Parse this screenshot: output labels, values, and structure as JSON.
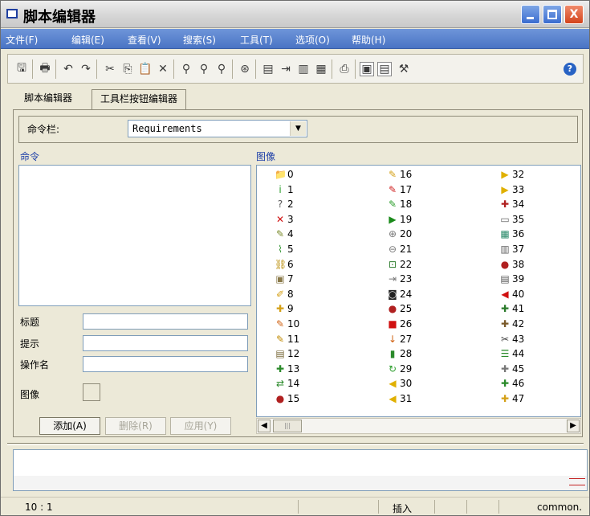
{
  "window": {
    "title": "脚本编辑器",
    "controls": {
      "minimize": "_",
      "maximize": "□",
      "close": "X"
    }
  },
  "menu": [
    {
      "label": "文件(F)"
    },
    {
      "label": "编辑(E)"
    },
    {
      "label": "查看(V)"
    },
    {
      "label": "搜索(S)"
    },
    {
      "label": "工具(T)"
    },
    {
      "label": "选项(O)"
    },
    {
      "label": "帮助(H)"
    }
  ],
  "toolbar": {
    "icons": [
      "save-icon",
      "print-icon",
      "undo-icon",
      "redo-icon",
      "cut-icon",
      "copy-icon",
      "paste-icon",
      "delete-icon",
      "find-icon",
      "find-next-icon",
      "replace-icon",
      "goto-icon",
      "list-icon",
      "insert-icon",
      "doc-icon",
      "doc2-icon",
      "preview-icon",
      "view1-icon",
      "view2-icon",
      "tools-icon"
    ],
    "help_label": "?"
  },
  "tabs": [
    {
      "label": "脚本编辑器",
      "active": false
    },
    {
      "label": "工具栏按钮编辑器",
      "active": true
    }
  ],
  "command_bar": {
    "label": "命令栏:",
    "selected": "Requirements"
  },
  "sections": {
    "commands": "命令",
    "images": "图像"
  },
  "form": {
    "title_label": "标题",
    "tip_label": "提示",
    "action_label": "操作名",
    "image_label": "图像"
  },
  "buttons": {
    "add": "添加(A)",
    "delete": "删除(R)",
    "apply": "应用(Y)"
  },
  "images": [
    {
      "n": "0",
      "icon": "📁",
      "color": "#d4a017"
    },
    {
      "n": "1",
      "icon": "i",
      "color": "#2a9d2a"
    },
    {
      "n": "2",
      "icon": "?",
      "color": "#555"
    },
    {
      "n": "3",
      "icon": "✕",
      "color": "#d01010"
    },
    {
      "n": "4",
      "icon": "✎",
      "color": "#7a8a2a"
    },
    {
      "n": "5",
      "icon": "⌇",
      "color": "#3b9a3b"
    },
    {
      "n": "6",
      "icon": "⛓",
      "color": "#b88a00"
    },
    {
      "n": "7",
      "icon": "▣",
      "color": "#8a7a4a"
    },
    {
      "n": "8",
      "icon": "✐",
      "color": "#d4a017"
    },
    {
      "n": "9",
      "icon": "✚",
      "color": "#d4a017"
    },
    {
      "n": "10",
      "icon": "✎",
      "color": "#d06010"
    },
    {
      "n": "11",
      "icon": "✎",
      "color": "#c08a00"
    },
    {
      "n": "12",
      "icon": "▤",
      "color": "#7a6a3a"
    },
    {
      "n": "13",
      "icon": "✚",
      "color": "#2a8a2a"
    },
    {
      "n": "14",
      "icon": "⇄",
      "color": "#2a8a2a"
    },
    {
      "n": "15",
      "icon": "●",
      "color": "#b02020"
    },
    {
      "n": "16",
      "icon": "✎",
      "color": "#d4a017"
    },
    {
      "n": "17",
      "icon": "✎",
      "color": "#d02020"
    },
    {
      "n": "18",
      "icon": "✎",
      "color": "#2a9d2a"
    },
    {
      "n": "19",
      "icon": "▶",
      "color": "#1a8a1a"
    },
    {
      "n": "20",
      "icon": "⊕",
      "color": "#777"
    },
    {
      "n": "21",
      "icon": "⊖",
      "color": "#777"
    },
    {
      "n": "22",
      "icon": "⊡",
      "color": "#2a7a2a"
    },
    {
      "n": "23",
      "icon": "⇥",
      "color": "#777"
    },
    {
      "n": "24",
      "icon": "◙",
      "color": "#222"
    },
    {
      "n": "25",
      "icon": "●",
      "color": "#b02020"
    },
    {
      "n": "26",
      "icon": "■",
      "color": "#d01010"
    },
    {
      "n": "27",
      "icon": "↓",
      "color": "#d06010"
    },
    {
      "n": "28",
      "icon": "▮",
      "color": "#2a8a2a"
    },
    {
      "n": "29",
      "icon": "↻",
      "color": "#2a9d2a"
    },
    {
      "n": "30",
      "icon": "◀",
      "color": "#e0b000"
    },
    {
      "n": "31",
      "icon": "◀",
      "color": "#e0b000"
    },
    {
      "n": "32",
      "icon": "▶",
      "color": "#e0b000"
    },
    {
      "n": "33",
      "icon": "▶",
      "color": "#e0b000"
    },
    {
      "n": "34",
      "icon": "✚",
      "color": "#b02020"
    },
    {
      "n": "35",
      "icon": "▭",
      "color": "#666"
    },
    {
      "n": "36",
      "icon": "▦",
      "color": "#2a8a6a"
    },
    {
      "n": "37",
      "icon": "▥",
      "color": "#666"
    },
    {
      "n": "38",
      "icon": "●",
      "color": "#b02020"
    },
    {
      "n": "39",
      "icon": "▤",
      "color": "#555"
    },
    {
      "n": "40",
      "icon": "◀",
      "color": "#d01010"
    },
    {
      "n": "41",
      "icon": "✚",
      "color": "#2a7a2a"
    },
    {
      "n": "42",
      "icon": "✚",
      "color": "#7a5a2a"
    },
    {
      "n": "43",
      "icon": "✂",
      "color": "#444"
    },
    {
      "n": "44",
      "icon": "☰",
      "color": "#2a8a2a"
    },
    {
      "n": "45",
      "icon": "✚",
      "color": "#777"
    },
    {
      "n": "46",
      "icon": "✚",
      "color": "#2a8a2a"
    },
    {
      "n": "47",
      "icon": "✚",
      "color": "#d4a017"
    }
  ],
  "status": {
    "position": "10 : 1",
    "mode": "插入",
    "profile": "common."
  }
}
